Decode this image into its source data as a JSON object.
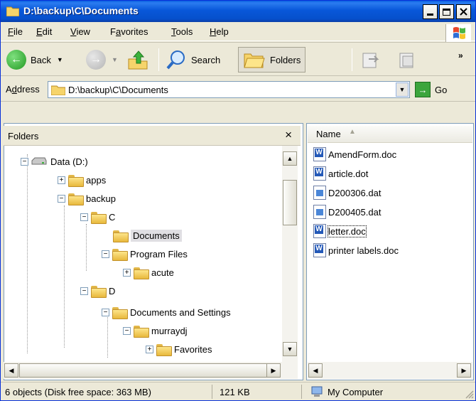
{
  "window": {
    "title": "D:\\backup\\C\\Documents"
  },
  "menu": [
    {
      "label": "File",
      "key": "F",
      "rest": "ile"
    },
    {
      "label": "Edit",
      "key": "E",
      "rest": "dit"
    },
    {
      "label": "View",
      "key": "V",
      "rest": "iew"
    },
    {
      "label": "Favorites",
      "pre": "F",
      "key": "a",
      "rest": "vorites"
    },
    {
      "label": "Tools",
      "key": "T",
      "rest": "ools"
    },
    {
      "label": "Help",
      "key": "H",
      "rest": "elp"
    }
  ],
  "toolbar": {
    "back_label": "Back",
    "search_label": "Search",
    "folders_label": "Folders"
  },
  "address": {
    "label_pre": "A",
    "label_key": "d",
    "label_rest": "dress",
    "value": "D:\\backup\\C\\Documents",
    "go_label": "Go"
  },
  "folders_pane": {
    "title": "Folders",
    "close_glyph": "×",
    "tree": [
      {
        "label": "Data (D:)",
        "type": "drive",
        "sign": "−"
      },
      {
        "label": "apps",
        "sign": "+"
      },
      {
        "label": "backup",
        "sign": "−"
      },
      {
        "label": "C",
        "sign": "−"
      },
      {
        "label": "Documents",
        "sign": "",
        "selected": true
      },
      {
        "label": "Program Files",
        "sign": "−"
      },
      {
        "label": "acute",
        "sign": "+"
      },
      {
        "label": "D",
        "sign": "−"
      },
      {
        "label": "Documents and Settings",
        "sign": "−"
      },
      {
        "label": "murraydj",
        "sign": "−"
      },
      {
        "label": "Favorites",
        "sign": "+"
      }
    ]
  },
  "files_pane": {
    "column_name": "Name",
    "files": [
      {
        "name": "AmendForm.doc",
        "kind": "word"
      },
      {
        "name": "article.dot",
        "kind": "word"
      },
      {
        "name": "D200306.dat",
        "kind": "dat"
      },
      {
        "name": "D200405.dat",
        "kind": "dat"
      },
      {
        "name": "letter.doc",
        "kind": "word",
        "focused": true
      },
      {
        "name": "printer labels.doc",
        "kind": "word"
      }
    ]
  },
  "status": {
    "objects": "6 objects (Disk free space: 363 MB)",
    "size": "121 KB",
    "zone": "My Computer"
  }
}
